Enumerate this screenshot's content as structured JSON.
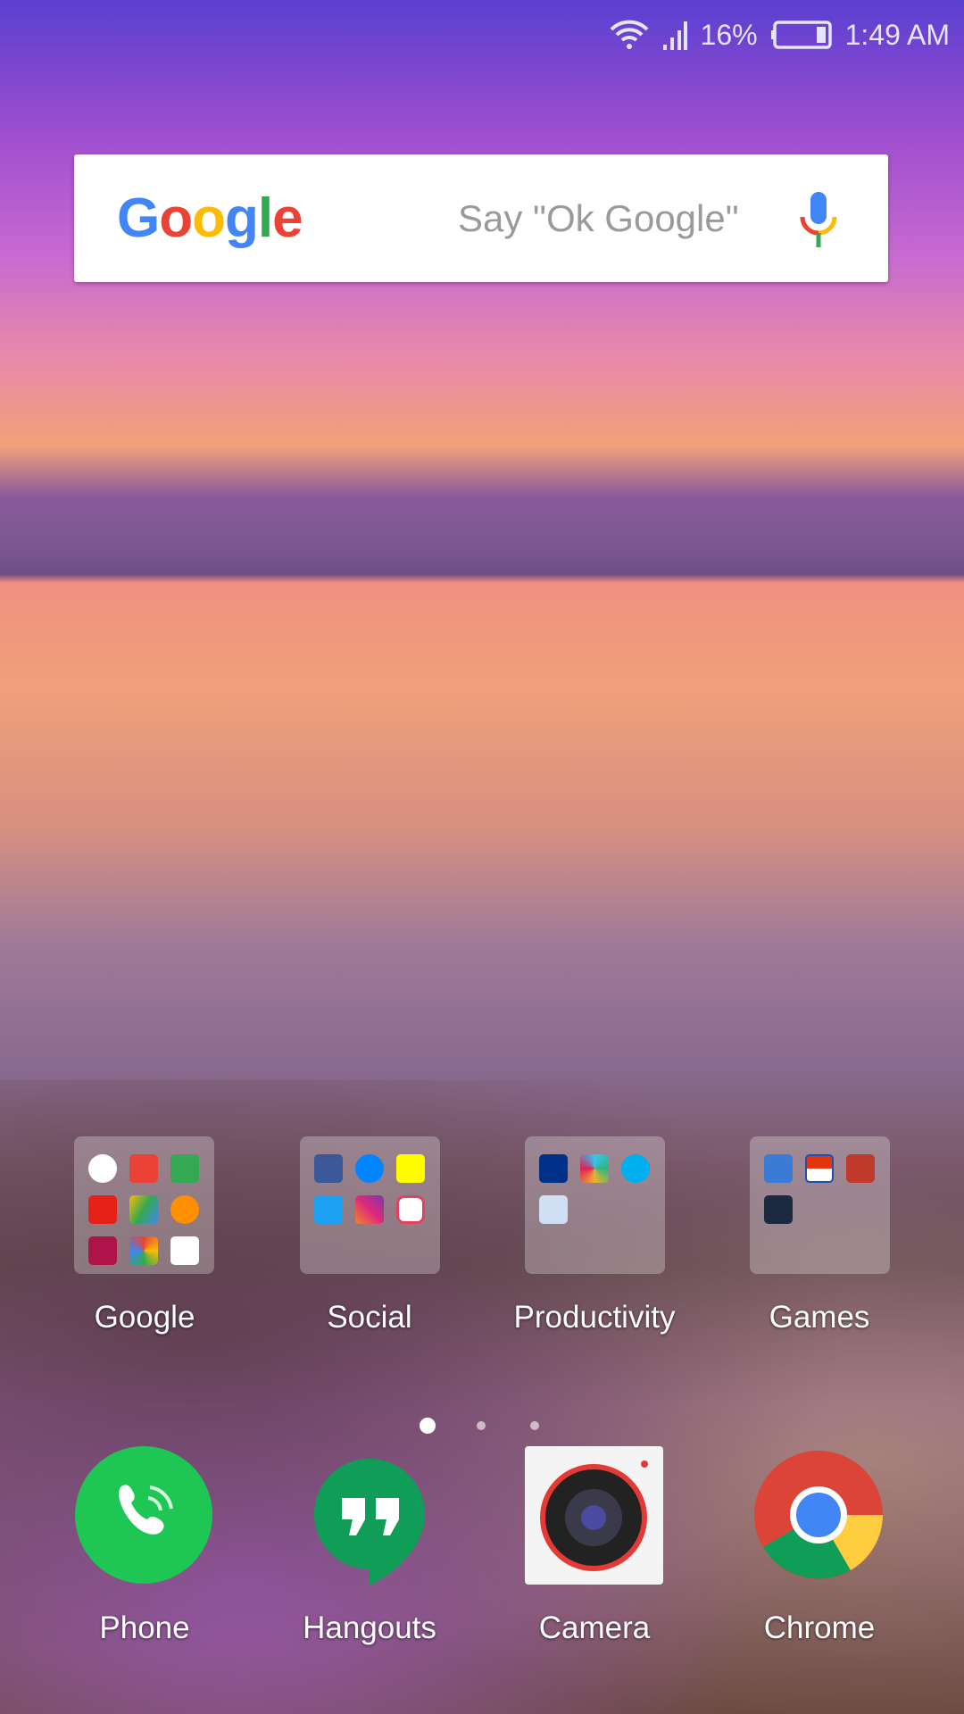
{
  "status": {
    "battery_percent": "16%",
    "time": "1:49 AM",
    "icons": [
      "wifi-icon",
      "signal-icon",
      "battery-icon"
    ]
  },
  "search": {
    "logo": "Google",
    "hint": "Say \"Ok Google\"",
    "mic_icon": "mic-icon"
  },
  "folders": [
    {
      "label": "Google",
      "apps": [
        "google",
        "gmail",
        "maps",
        "youtube",
        "drive",
        "play-music",
        "play-movies",
        "photos",
        "play-store"
      ]
    },
    {
      "label": "Social",
      "apps": [
        "facebook",
        "messenger",
        "snapchat",
        "twitter",
        "instagram",
        "layout"
      ]
    },
    {
      "label": "Productivity",
      "apps": [
        "paypal",
        "slack",
        "groupme",
        "vote"
      ]
    },
    {
      "label": "Games",
      "apps": [
        "clash-royale",
        "pokemon-go",
        "csr2",
        "need-for-speed"
      ]
    }
  ],
  "page_indicator": {
    "current": 1,
    "total": 3
  },
  "dock": [
    {
      "label": "Phone"
    },
    {
      "label": "Hangouts"
    },
    {
      "label": "Camera"
    },
    {
      "label": "Chrome"
    }
  ],
  "colors": {
    "google_blue": "#4285f4",
    "google_red": "#ea4335",
    "google_yellow": "#fbbc05",
    "google_green": "#34a853"
  }
}
